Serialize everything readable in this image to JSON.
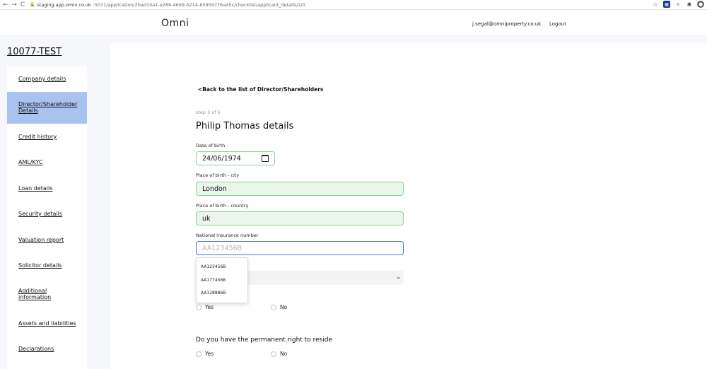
{
  "browser": {
    "back_icon": "←",
    "forward_icon": "→",
    "reload_icon": "C",
    "url_host": "staging.app.omni.co.uk",
    "url_path": ":5011/application/2bad10a1-e289-4699-b214-85959776a45c/checklist/applicant_details/2/0",
    "ext_star": "☆",
    "ext_sq": "▦",
    "ext_leaf": "✧",
    "ext_puzzle": "✱",
    "ext_user": "●"
  },
  "header": {
    "logo": "Omni",
    "email": "j.segal@omniproperty.co.uk",
    "logout": "Logout"
  },
  "app_id": "10077-TEST",
  "sidebar": {
    "items": [
      {
        "label": "Company details",
        "active": false
      },
      {
        "label": "Director/Shareholder Details",
        "active": true
      },
      {
        "label": "Credit history",
        "active": false
      },
      {
        "label": "AML/KYC",
        "active": false
      },
      {
        "label": "Loan details",
        "active": false
      },
      {
        "label": "Security details",
        "active": false
      },
      {
        "label": "Valuation report",
        "active": false
      },
      {
        "label": "Solicitor details",
        "active": false
      },
      {
        "label": "Additional information",
        "active": false
      },
      {
        "label": "Assets and liabilities",
        "active": false
      },
      {
        "label": "Declarations",
        "active": false
      }
    ]
  },
  "main": {
    "back_link": "<Back to the list of Director/Shareholders",
    "step": "step 3 of 5",
    "title": "Philip Thomas details",
    "fields": {
      "dob": {
        "label": "Date of birth",
        "value": "24/06/1974"
      },
      "city": {
        "label": "Place of birth - city",
        "value": "London"
      },
      "country": {
        "label": "Place of birth - country",
        "value": "uk"
      },
      "ni": {
        "label": "National insurance number",
        "value": "",
        "placeholder": "AA123456B"
      }
    },
    "autocomplete": [
      "AA123456B",
      "AA177456B",
      "AA128886B"
    ],
    "radio1": {
      "yes": "Yes",
      "no": "No"
    },
    "question2": "Do you have the permanent right to reside",
    "radio2": {
      "yes": "Yes",
      "no": "No"
    }
  },
  "colors": {
    "accent_active": "#a9c2f0",
    "valid_border": "#8ad28f",
    "valid_bg": "#eaf6ec",
    "focus_border": "#4a78d6"
  }
}
